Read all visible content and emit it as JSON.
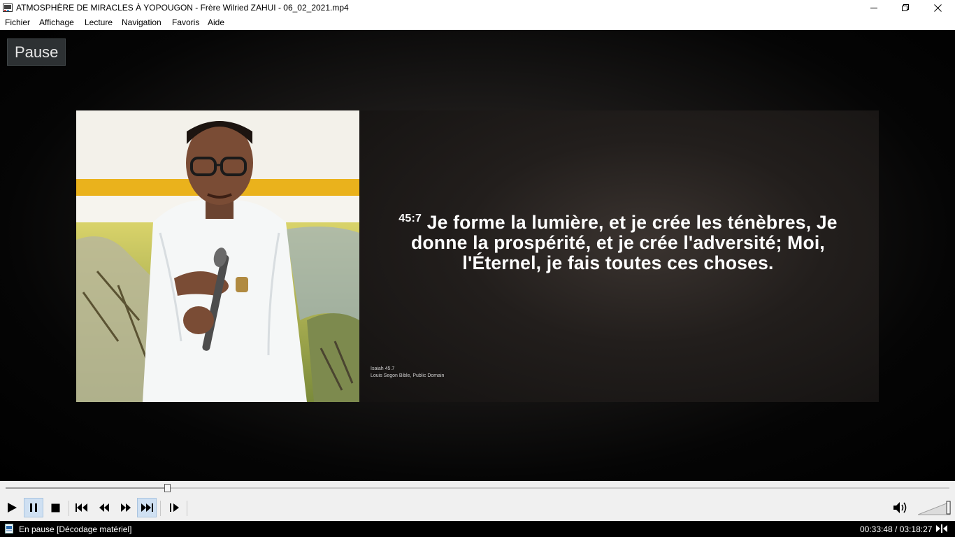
{
  "window": {
    "title": "ATMOSPHÈRE DE MIRACLES À YOPOUGON - Frère Wilried ZAHUI - 06_02_2021.mp4",
    "icons": [
      "media-player-icon",
      "minimize-icon",
      "restore-icon",
      "close-icon"
    ]
  },
  "menu": {
    "items": [
      {
        "label": "Fichier"
      },
      {
        "label": "Affichage"
      },
      {
        "label": "Lecture"
      },
      {
        "label": "Navigation"
      },
      {
        "label": "Favoris"
      },
      {
        "label": "Aide"
      }
    ]
  },
  "video": {
    "osd_label": "Pause",
    "verse_number": "45:7",
    "verse_lines": [
      "Je forme la lumière, et je crée les ténèbres, Je",
      "donne la prospérité, et je crée l'adversité; Moi,",
      "l'Éternel, je fais toutes ces choses."
    ],
    "reference_line1": "Isaiah 45.7",
    "reference_line2": "Louis Segon Bible, Public Domain"
  },
  "seek": {
    "progress_fraction": 0.171
  },
  "controls": {
    "buttons": [
      "play-icon",
      "pause-icon",
      "stop-icon",
      "skip-back-icon",
      "rewind-icon",
      "fast-forward-icon",
      "skip-forward-icon",
      "frame-step-icon",
      "volume-icon"
    ],
    "active": [
      "pause-icon",
      "skip-forward-icon"
    ],
    "volume_fraction": 0.85
  },
  "status": {
    "text": "En pause [Décodage matériel]",
    "time": "00:33:48 / 03:18:27"
  },
  "colors": {
    "active_button_bg": "#cfe0f2",
    "video_bg": "#000000",
    "status_bg": "#000000"
  }
}
